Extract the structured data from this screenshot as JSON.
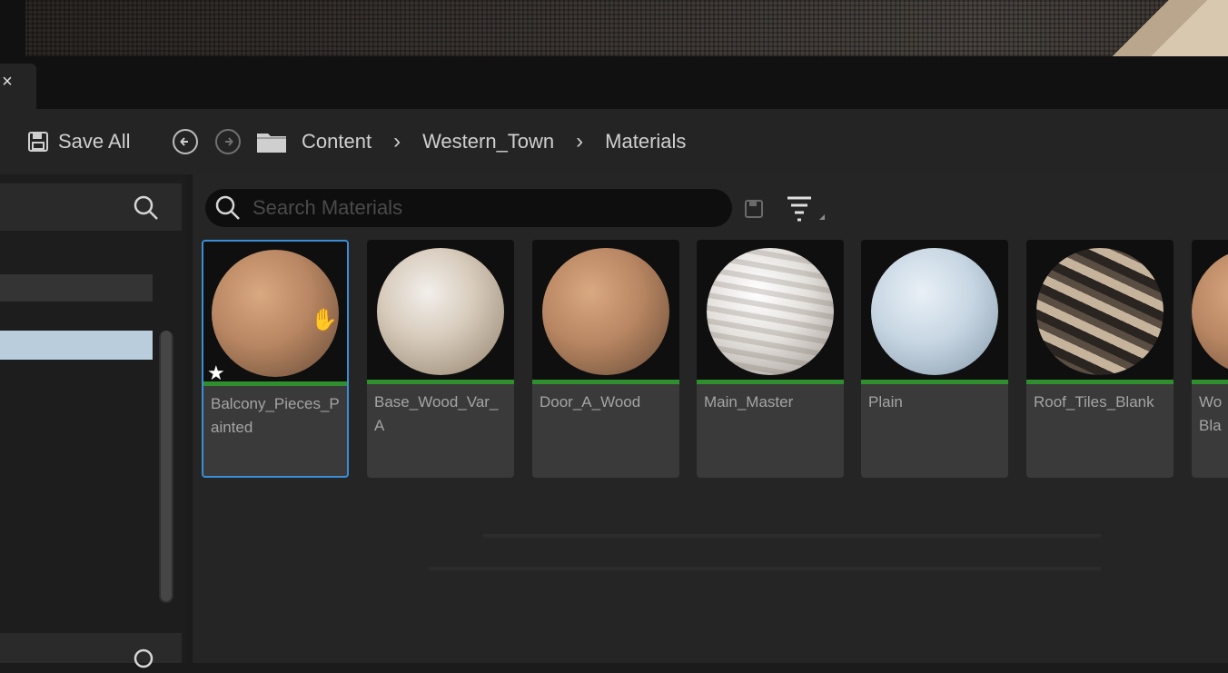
{
  "tab": {
    "close": "×"
  },
  "toolbar": {
    "save_all_label": "Save All",
    "save_icon": "save-icon",
    "back_icon": "arrow-left-circle-icon",
    "forward_icon": "arrow-right-circle-icon",
    "folder_icon": "folder-icon"
  },
  "breadcrumb": {
    "items": [
      "Content",
      "Western_Town",
      "Materials"
    ],
    "separator": "›"
  },
  "search": {
    "placeholder": "Search Materials"
  },
  "assets": [
    {
      "label": "Balcony_Pieces_Painted",
      "favorite": "★",
      "selected": true,
      "swatch": "tan"
    },
    {
      "label": "Base_Wood_Var_A",
      "selected": false,
      "swatch": "white"
    },
    {
      "label": "Door_A_Wood",
      "selected": false,
      "swatch": "tan"
    },
    {
      "label": "Main_Master",
      "selected": false,
      "swatch": "marble"
    },
    {
      "label": "Plain",
      "selected": false,
      "swatch": "blue"
    },
    {
      "label": "Roof_Tiles_Blank",
      "selected": false,
      "swatch": "roof"
    },
    {
      "label": "Wo Bla",
      "selected": false,
      "swatch": "tan"
    }
  ],
  "colors": {
    "selection": "#3a8dd6",
    "asset_type_bar": "#2f8f2f",
    "panel_bg": "#242424"
  }
}
